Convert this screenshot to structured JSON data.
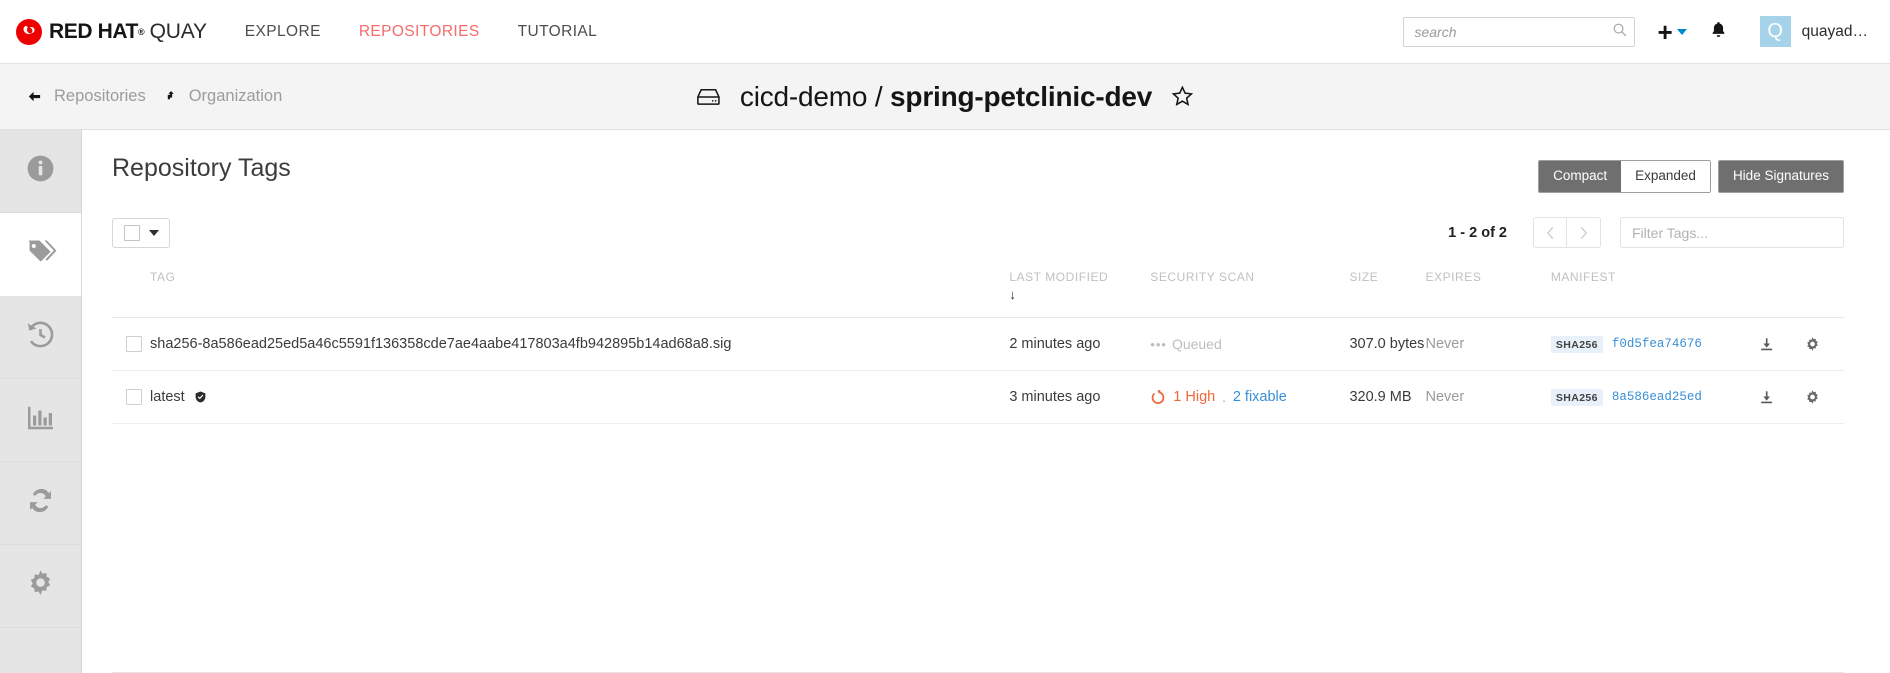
{
  "topnav": {
    "brand": {
      "redhat": "RED HAT",
      "reg": "®",
      "quay": "QUAY",
      "logo_icon": "red-hat-logo-icon"
    },
    "links": [
      {
        "label": "EXPLORE",
        "active": false
      },
      {
        "label": "REPOSITORIES",
        "active": true
      },
      {
        "label": "TUTORIAL",
        "active": false
      }
    ],
    "search": {
      "placeholder": "search",
      "value": ""
    },
    "create_icon": "plus-icon",
    "create_caret_icon": "caret-down-icon",
    "notifications_icon": "bell-icon",
    "user": {
      "avatar_letter": "Q",
      "name": "quayad…"
    }
  },
  "breadcrumb": {
    "back_icon": "arrow-left-icon",
    "repositories_label": "Repositories",
    "org_icon": "organization-arrow-icon",
    "organization_label": "Organization"
  },
  "repo_header": {
    "icon": "repository-drive-icon",
    "namespace": "cicd-demo",
    "separator": "/",
    "name": "spring-petclinic-dev",
    "star_icon": "star-outline-icon"
  },
  "sidebar": {
    "items": [
      {
        "icon": "information-icon",
        "name": "repository-information",
        "active": false
      },
      {
        "icon": "tags-icon",
        "name": "repository-tags",
        "active": true
      },
      {
        "icon": "history-clock-icon",
        "name": "tag-history",
        "active": false
      },
      {
        "icon": "bar-chart-icon",
        "name": "usage-logs",
        "active": false
      },
      {
        "icon": "sync-refresh-icon",
        "name": "mirroring",
        "active": false
      },
      {
        "icon": "gear-icon",
        "name": "settings",
        "active": false
      }
    ]
  },
  "main": {
    "title": "Repository Tags",
    "view_buttons": {
      "compact": "Compact",
      "expanded": "Expanded",
      "hide_signatures": "Hide Signatures"
    },
    "toolbar": {
      "select_all_icon": "checkbox-icon",
      "select_all_caret_icon": "caret-down-icon",
      "range": "1 - 2 of 2",
      "prev_icon": "chevron-left-icon",
      "next_icon": "chevron-right-icon",
      "filter_placeholder": "Filter Tags...",
      "filter_value": ""
    },
    "table": {
      "headers": {
        "tag": "TAG",
        "last_modified": "LAST MODIFIED",
        "sort_arrow": "↓",
        "security_scan": "SECURITY SCAN",
        "size": "SIZE",
        "expires": "EXPIRES",
        "manifest": "MANIFEST"
      },
      "rows": [
        {
          "tag": "sha256-8a586ead25ed5a46c5591f136358cde7ae4aabe417803a4fb942895b14ad68a8.sig",
          "signed": false,
          "last_modified": "2 minutes ago",
          "scan_type": "queued",
          "scan_queued_label": "Queued",
          "scan_high": "",
          "scan_fixable": "",
          "size": "307.0 bytes",
          "expires": "Never",
          "manifest_badge": "SHA256",
          "manifest_hash": "f0d5fea74676",
          "download_icon": "download-icon",
          "gear_icon": "gear-icon"
        },
        {
          "tag": "latest",
          "signed": true,
          "signed_icon": "shield-check-icon",
          "last_modified": "3 minutes ago",
          "scan_type": "vulnerable",
          "scan_queued_label": "",
          "scan_high": "1 High",
          "scan_separator": ".",
          "scan_fixable": "2 fixable",
          "size": "320.9 MB",
          "expires": "Never",
          "manifest_badge": "SHA256",
          "manifest_hash": "8a586ead25ed",
          "download_icon": "download-icon",
          "gear_icon": "gear-icon"
        }
      ]
    }
  },
  "colors": {
    "brand_red": "#e00000",
    "nav_active": "#f56b6b",
    "link_blue": "#3a8fd6",
    "vuln_orange": "#f0663a",
    "avatar_blue": "#a6d3ea"
  }
}
